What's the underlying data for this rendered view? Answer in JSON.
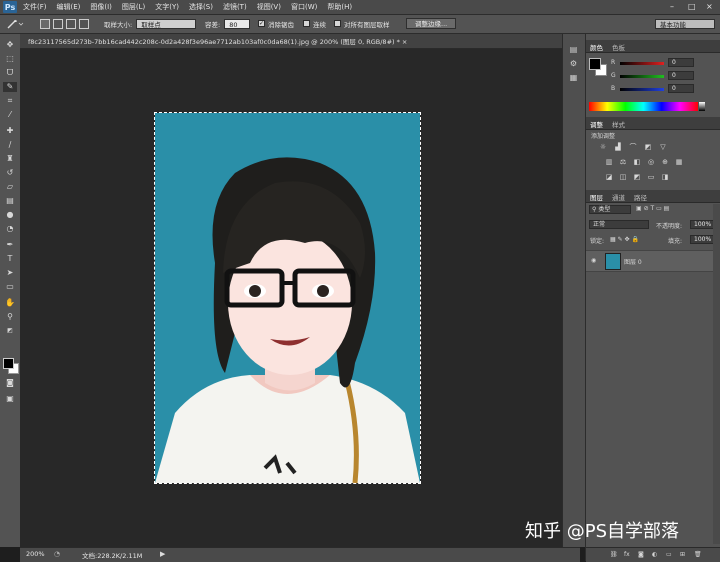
{
  "app": {
    "logo": "Ps"
  },
  "menu": [
    "文件(F)",
    "编辑(E)",
    "图像(I)",
    "图层(L)",
    "文字(Y)",
    "选择(S)",
    "滤镜(T)",
    "视图(V)",
    "窗口(W)",
    "帮助(H)"
  ],
  "window_controls": {
    "minimize": "–",
    "restore": "□",
    "close": "×"
  },
  "options": {
    "sample_size_label": "取样大小:",
    "sample_size_value": "取样点",
    "tolerance_label": "容差:",
    "tolerance_value": "80",
    "antialias_label": "消除锯齿",
    "contiguous_label": "连续",
    "all_layers_label": "对所有图层取样",
    "refine_edge_button": "调整边缘...",
    "workspace_value": "基本功能"
  },
  "document": {
    "tab_title": "f8c23117565d273b-7bb16cad442c208c-0d2a428f3e96ae7712ab103af0c0da68(1).jpg @ 200% (图层 0, RGB/8#) * ×",
    "zoom": "200%",
    "doc_size": "文档:228.2K/2.11M"
  },
  "color_panel": {
    "tabs": [
      "颜色",
      "色板"
    ],
    "channels": [
      {
        "label": "R",
        "value": "0",
        "color": "#d22"
      },
      {
        "label": "G",
        "value": "0",
        "color": "#2a2"
      },
      {
        "label": "B",
        "value": "0",
        "color": "#22d"
      }
    ]
  },
  "adjustments_panel": {
    "tabs": [
      "调整",
      "样式"
    ],
    "title": "添加调整"
  },
  "layers_panel": {
    "tabs": [
      "图层",
      "通道",
      "路径"
    ],
    "filter_value": "类型",
    "blend_mode": "正常",
    "opacity_label": "不透明度:",
    "opacity_value": "100%",
    "lock_label": "锁定:",
    "fill_label": "填充:",
    "fill_value": "100%",
    "layers": [
      {
        "name": "图层 0"
      }
    ]
  },
  "watermark": "知乎 @PS自学部落",
  "colors": {
    "canvas_bg": "#2a8fa8",
    "ui_dark": "#535353",
    "ui_darker": "#282828"
  }
}
